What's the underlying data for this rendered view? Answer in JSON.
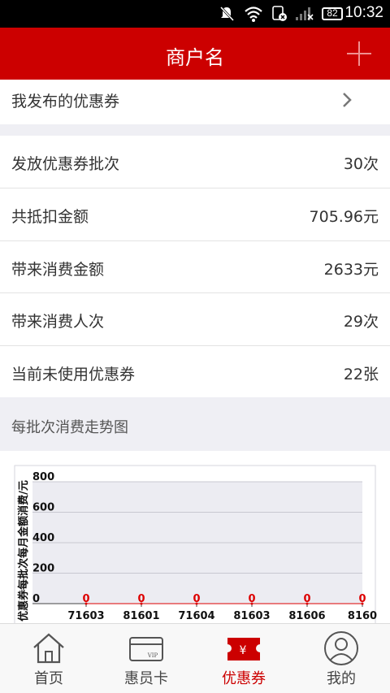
{
  "status_bar": {
    "time": "10:32",
    "battery": "82"
  },
  "header": {
    "title": "商户名"
  },
  "coupon_link": {
    "label": "我发布的优惠券"
  },
  "stats": [
    {
      "label": "发放优惠券批次",
      "value": "30次"
    },
    {
      "label": "共抵扣金额",
      "value": "705.96元"
    },
    {
      "label": "带来消费金额",
      "value": "2633元"
    },
    {
      "label": "带来消费人次",
      "value": "29次"
    },
    {
      "label": "当前未使用优惠券",
      "value": "22张"
    }
  ],
  "trend_section": {
    "title": "每批次消费走势图"
  },
  "chart_data": {
    "type": "line",
    "ylabel": "优惠券每批次每月金额消费/元",
    "ylim": [
      0,
      800
    ],
    "yticks": [
      "800",
      "600",
      "400",
      "200",
      "0"
    ],
    "categories": [
      "71603",
      "81601",
      "71604",
      "81603",
      "81606",
      "8160"
    ],
    "values": [
      0,
      0,
      0,
      0,
      0,
      0
    ],
    "data_labels": [
      "0",
      "0",
      "0",
      "0",
      "0",
      "0"
    ],
    "grid": true
  },
  "tabs": [
    {
      "label": "首页",
      "icon": "home-icon"
    },
    {
      "label": "惠员卡",
      "icon": "vip-card-icon"
    },
    {
      "label": "优惠券",
      "icon": "coupon-icon"
    },
    {
      "label": "我的",
      "icon": "profile-icon"
    }
  ],
  "colors": {
    "brand": "#cc0000",
    "data_label": "#dd0000",
    "grid": "#c8c8d0",
    "plot_bg": "#ececf2"
  }
}
